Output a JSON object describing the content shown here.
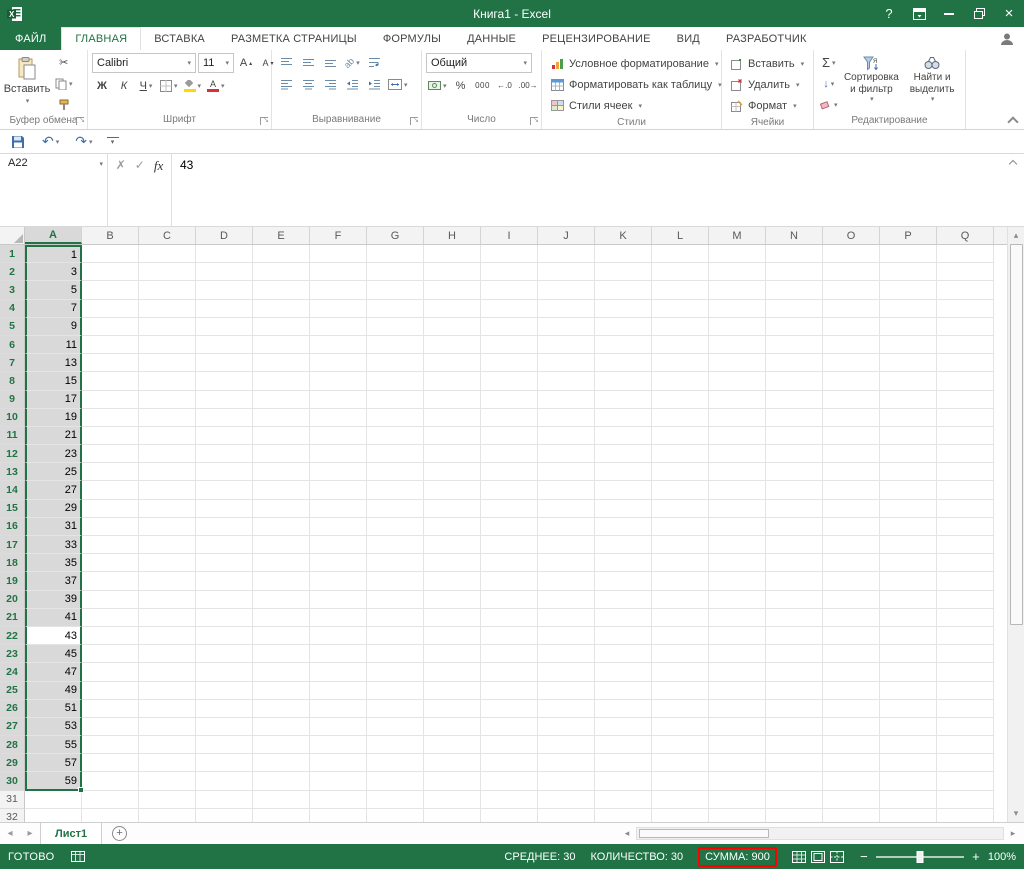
{
  "window": {
    "title": "Книга1 - Excel",
    "help": "?"
  },
  "icons": {
    "dropdown": "▾",
    "cut": "✂",
    "undo": "↶",
    "redo": "↷",
    "check": "✓",
    "cancel": "✗",
    "fx": "fx",
    "close": "×",
    "up": "▴",
    "down": "▾",
    "left": "◂",
    "right": "▸",
    "wrap": "↩",
    "orientation": "ab",
    "fill_down": "↓",
    "clear": "✗",
    "accent_green": "#217346",
    "selection_gray": "#d9d9d9",
    "annotation_red": "#ff0000"
  },
  "tabs": [
    {
      "label": "ФАЙЛ"
    },
    {
      "label": "ГЛАВНАЯ"
    },
    {
      "label": "ВСТАВКА"
    },
    {
      "label": "РАЗМЕТКА СТРАНИЦЫ"
    },
    {
      "label": "ФОРМУЛЫ"
    },
    {
      "label": "ДАННЫЕ"
    },
    {
      "label": "РЕЦЕНЗИРОВАНИЕ"
    },
    {
      "label": "ВИД"
    },
    {
      "label": "РАЗРАБОТЧИК"
    }
  ],
  "ribbon": {
    "clipboard": {
      "label": "Буфер обмена",
      "paste": "Вставить"
    },
    "font": {
      "label": "Шрифт",
      "name": "Calibri",
      "size": "11",
      "bold": "Ж",
      "italic": "К",
      "underline": "Ч",
      "grow": "А",
      "shrink": "А",
      "color_letter": "А"
    },
    "alignment": {
      "label": "Выравнивание"
    },
    "number": {
      "label": "Число",
      "format": "Общий",
      "percent": "%",
      "thousands": "000",
      "inc_decimal": "←.0",
      "dec_decimal": ".00→"
    },
    "styles": {
      "label": "Стили",
      "conditional": "Условное форматирование",
      "as_table": "Форматировать как таблицу",
      "cell_styles": "Стили ячеек"
    },
    "cells": {
      "label": "Ячейки",
      "insert": "Вставить",
      "remove": "Удалить",
      "format": "Формат"
    },
    "editing": {
      "label": "Редактирование",
      "autosum": "Σ",
      "sort": "Сортировка и фильтр",
      "find": "Найти и выделить"
    }
  },
  "formula_bar": {
    "name_box": "A22",
    "value": "43"
  },
  "spreadsheet": {
    "columns": [
      "A",
      "B",
      "C",
      "D",
      "E",
      "F",
      "G",
      "H",
      "I",
      "J",
      "K",
      "L",
      "M",
      "N",
      "O",
      "P",
      "Q"
    ],
    "visible_rows": 32,
    "selected_column": "A",
    "selected_row_count": 30,
    "active_cell": "A22",
    "active_row": 22,
    "values_column_a": [
      1,
      3,
      5,
      7,
      9,
      11,
      13,
      15,
      17,
      19,
      21,
      23,
      25,
      27,
      29,
      31,
      33,
      35,
      37,
      39,
      41,
      43,
      45,
      47,
      49,
      51,
      53,
      55,
      57,
      59
    ]
  },
  "sheet_bar": {
    "sheet_name": "Лист1",
    "add": "+"
  },
  "status_bar": {
    "mode": "ГОТОВО",
    "average": "СРЕДНЕЕ: 30",
    "count": "КОЛИЧЕСТВО: 30",
    "sum": "СУММА: 900",
    "zoom": "100%"
  }
}
